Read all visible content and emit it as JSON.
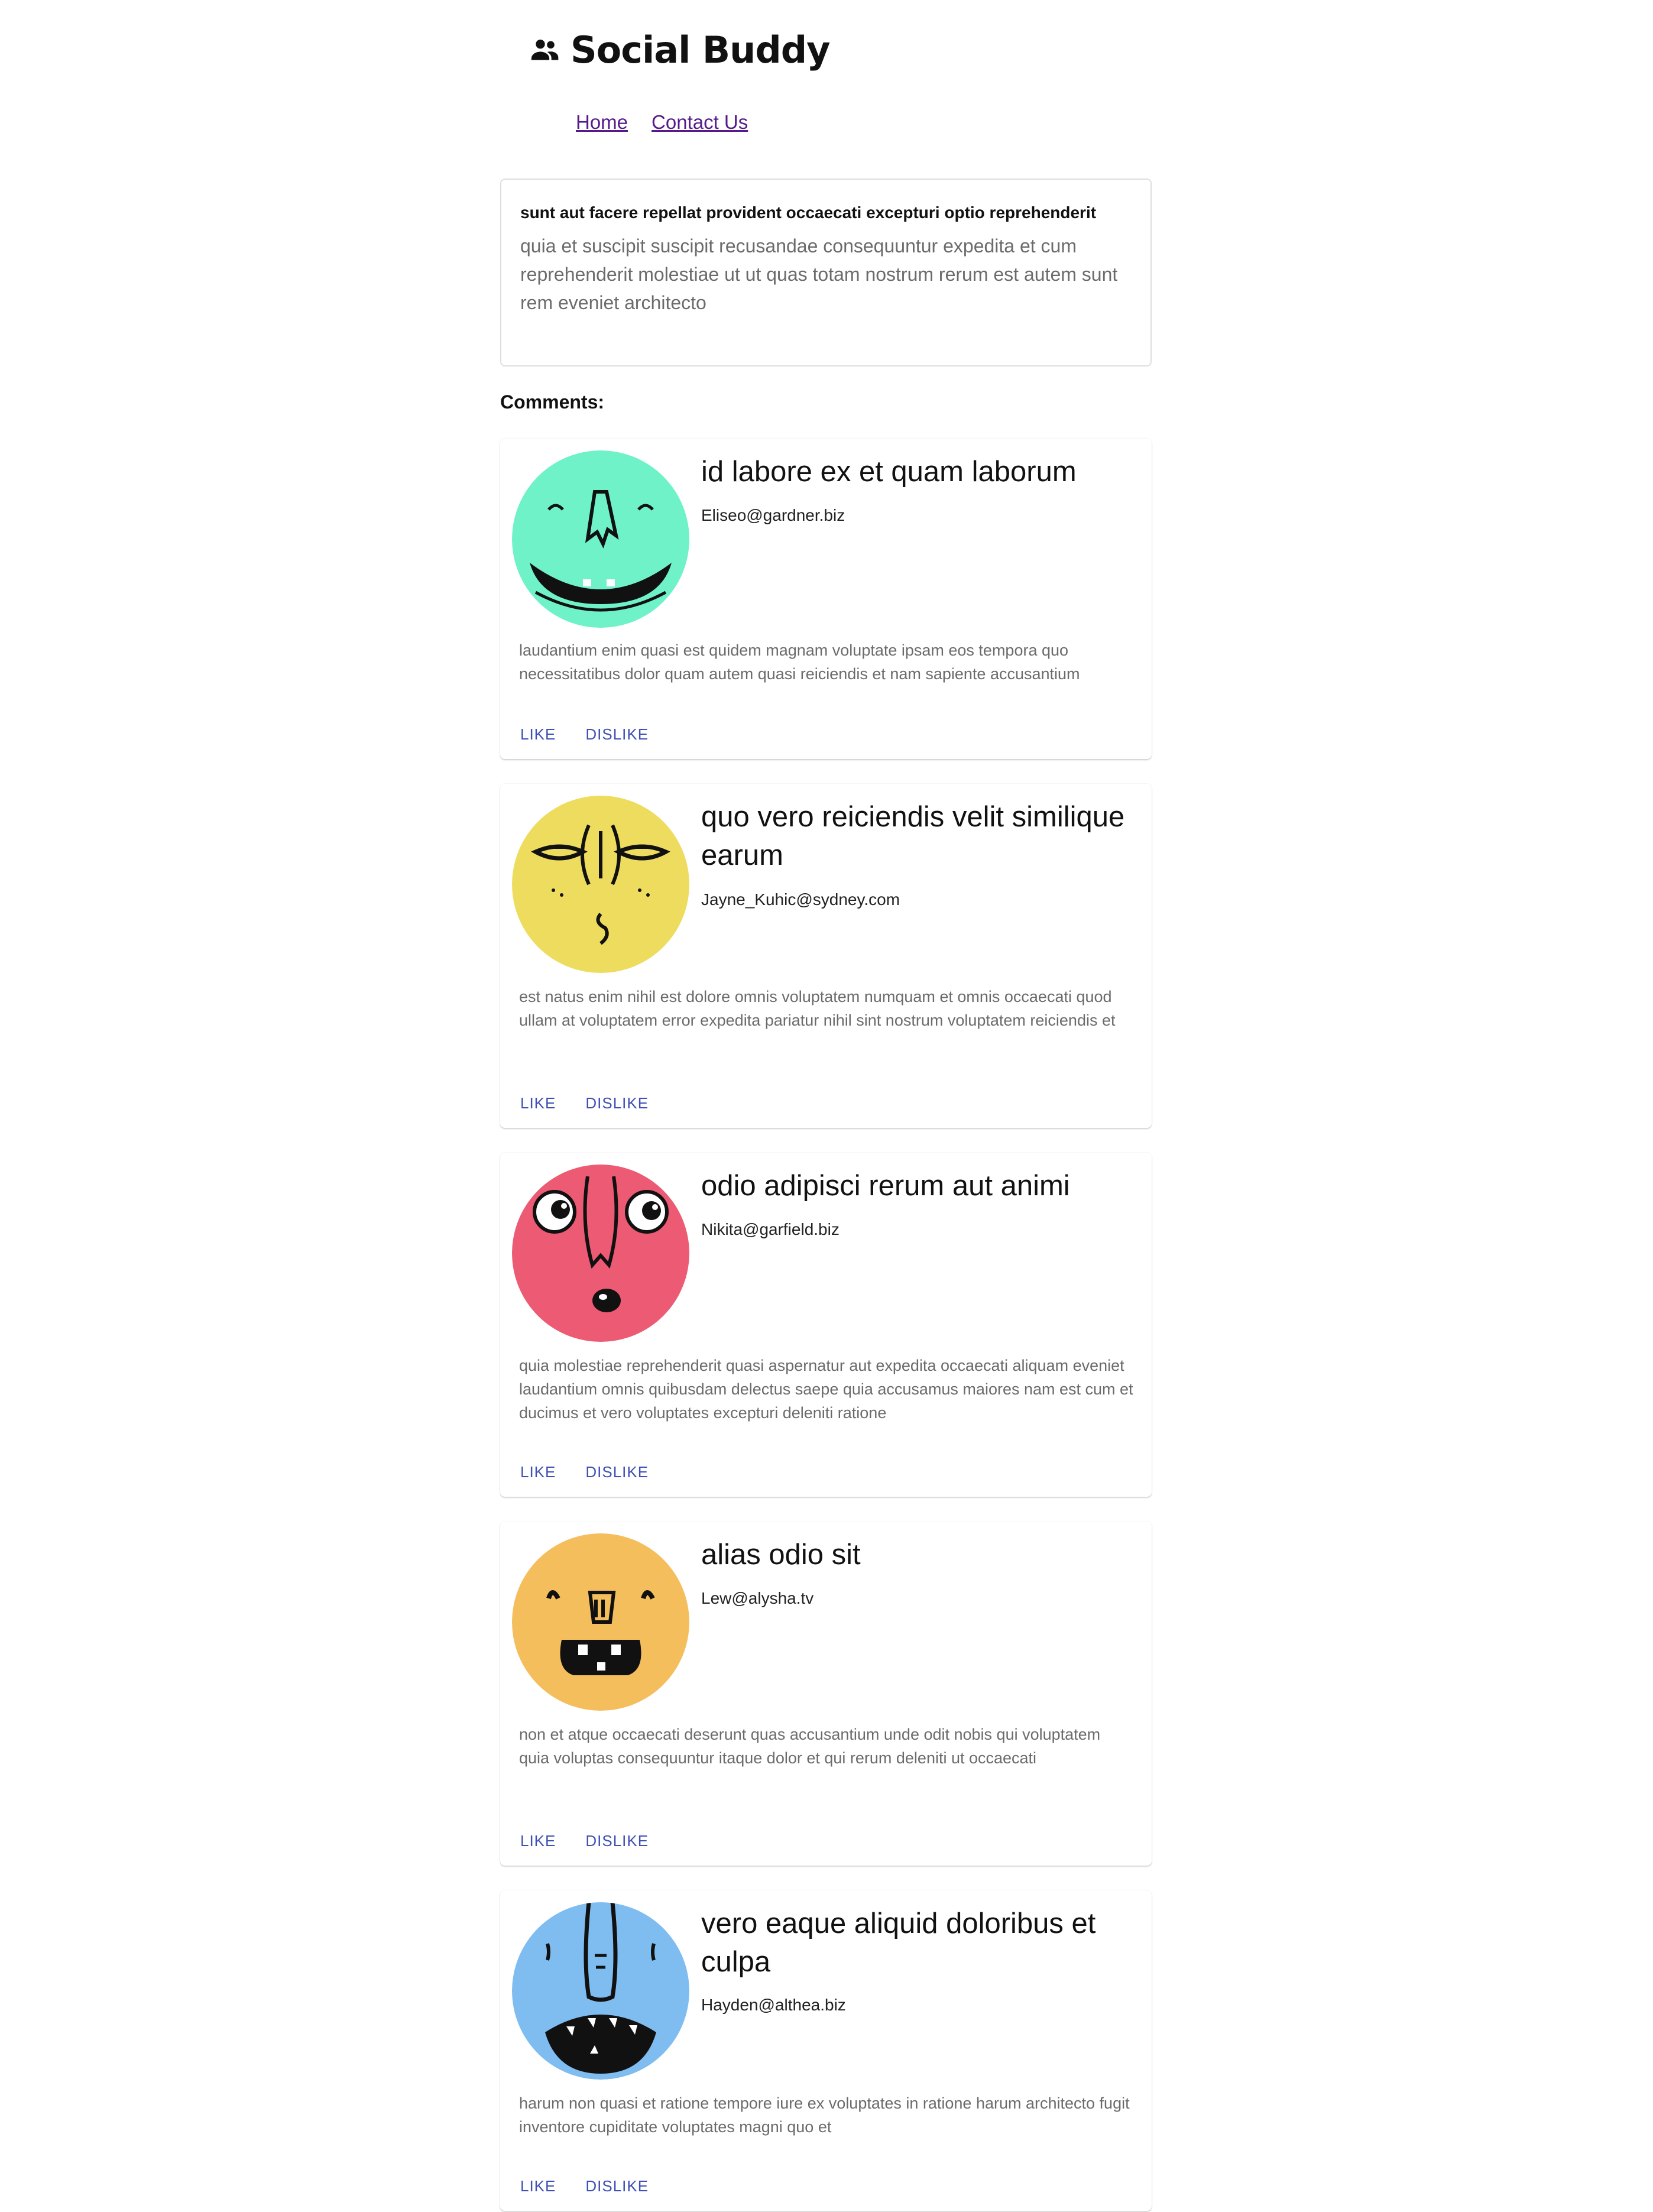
{
  "header": {
    "title": "Social Buddy",
    "icon": "people-icon"
  },
  "nav": {
    "home": "Home",
    "contact": "Contact Us"
  },
  "post": {
    "title": "sunt aut facere repellat provident occaecati excepturi optio reprehenderit",
    "body": "quia et suscipit suscipit recusandae consequuntur expedita et cum reprehenderit molestiae ut ut quas totam nostrum rerum est autem sunt rem eveniet architecto"
  },
  "comments_heading": "Comments:",
  "comments": [
    {
      "name": "id labore ex et quam laborum",
      "email": "Eliseo@gardner.biz",
      "body": "laudantium enim quasi est quidem magnam voluptate ipsam eos tempora quo necessitatibus dolor quam autem quasi reiciendis et nam sapiente accusantium",
      "like": "LIKE",
      "dislike": "DISLIKE",
      "avatar_color": "#6ff2c8"
    },
    {
      "name": "quo vero reiciendis velit similique earum",
      "email": "Jayne_Kuhic@sydney.com",
      "body": "est natus enim nihil est dolore omnis voluptatem numquam et omnis occaecati quod ullam at voluptatem error expedita pariatur nihil sint nostrum voluptatem reiciendis et",
      "like": "LIKE",
      "dislike": "DISLIKE",
      "avatar_color": "#eedc5e"
    },
    {
      "name": "odio adipisci rerum aut animi",
      "email": "Nikita@garfield.biz",
      "body": "quia molestiae reprehenderit quasi aspernatur aut expedita occaecati aliquam eveniet laudantium omnis quibusdam delectus saepe quia accusamus maiores nam est cum et ducimus et vero voluptates excepturi deleniti ratione",
      "like": "LIKE",
      "dislike": "DISLIKE",
      "avatar_color": "#ec5a73"
    },
    {
      "name": "alias odio sit",
      "email": "Lew@alysha.tv",
      "body": "non et atque occaecati deserunt quas accusantium unde odit nobis qui voluptatem quia voluptas consequuntur itaque dolor et qui rerum deleniti ut occaecati",
      "like": "LIKE",
      "dislike": "DISLIKE",
      "avatar_color": "#f5be5d"
    },
    {
      "name": "vero eaque aliquid doloribus et culpa",
      "email": "Hayden@althea.biz",
      "body": "harum non quasi et ratione tempore iure ex voluptates in ratione harum architecto fugit inventore cupiditate voluptates magni quo et",
      "like": "LIKE",
      "dislike": "DISLIKE",
      "avatar_color": "#7fbdf1"
    }
  ]
}
